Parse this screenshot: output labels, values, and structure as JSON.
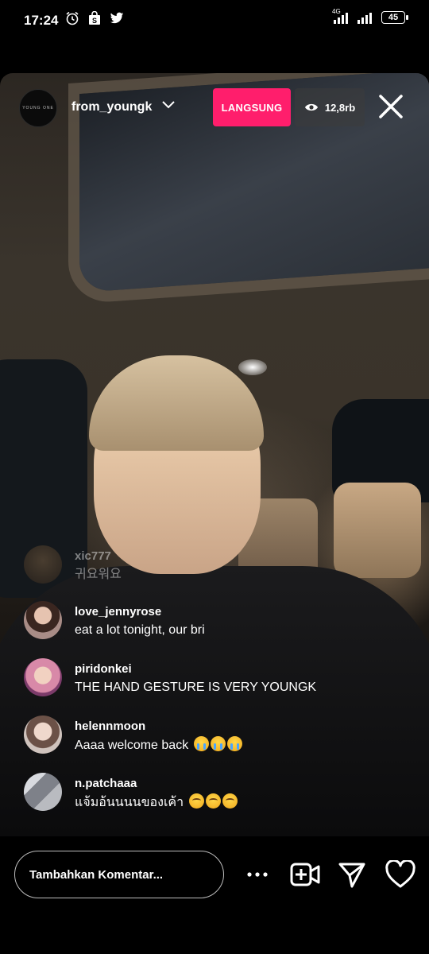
{
  "status_bar": {
    "time": "17:24",
    "network": "4G",
    "battery": "45",
    "icons": [
      "alarm-icon",
      "shopping-bag-icon",
      "twitter-icon"
    ]
  },
  "live": {
    "host_username": "from_youngk",
    "host_avatar_text": "YOUNG ONE",
    "live_label": "LANGSUNG",
    "viewer_count": "12,8rb",
    "accent_color": "#ff1e6c"
  },
  "comments": [
    {
      "username": "xic777",
      "text": "귀요워요",
      "faded": true,
      "avatar_color": "#6b5238"
    },
    {
      "username": "love_jennyrose",
      "text": "eat a lot tonight, our bri",
      "avatar_color": "#8f6f6a"
    },
    {
      "username": "piridonkei",
      "text": "THE HAND GESTURE IS VERY YOUNGK",
      "avatar_color": "#c98aa0"
    },
    {
      "username": "helennmoon",
      "text": "Aaaa welcome back",
      "emoji": [
        "loudly-crying-face",
        "loudly-crying-face",
        "loudly-crying-face"
      ],
      "avatar_color": "#c9b4a8"
    },
    {
      "username": "n.patchaaa",
      "text": "แจ้มอ้นนนนของเค้า",
      "emoji": [
        "pleading-face",
        "pleading-face",
        "pleading-face"
      ],
      "avatar_color": "#a6a8ad"
    }
  ],
  "bottom_bar": {
    "comment_placeholder": "Tambahkan Komentar..."
  }
}
